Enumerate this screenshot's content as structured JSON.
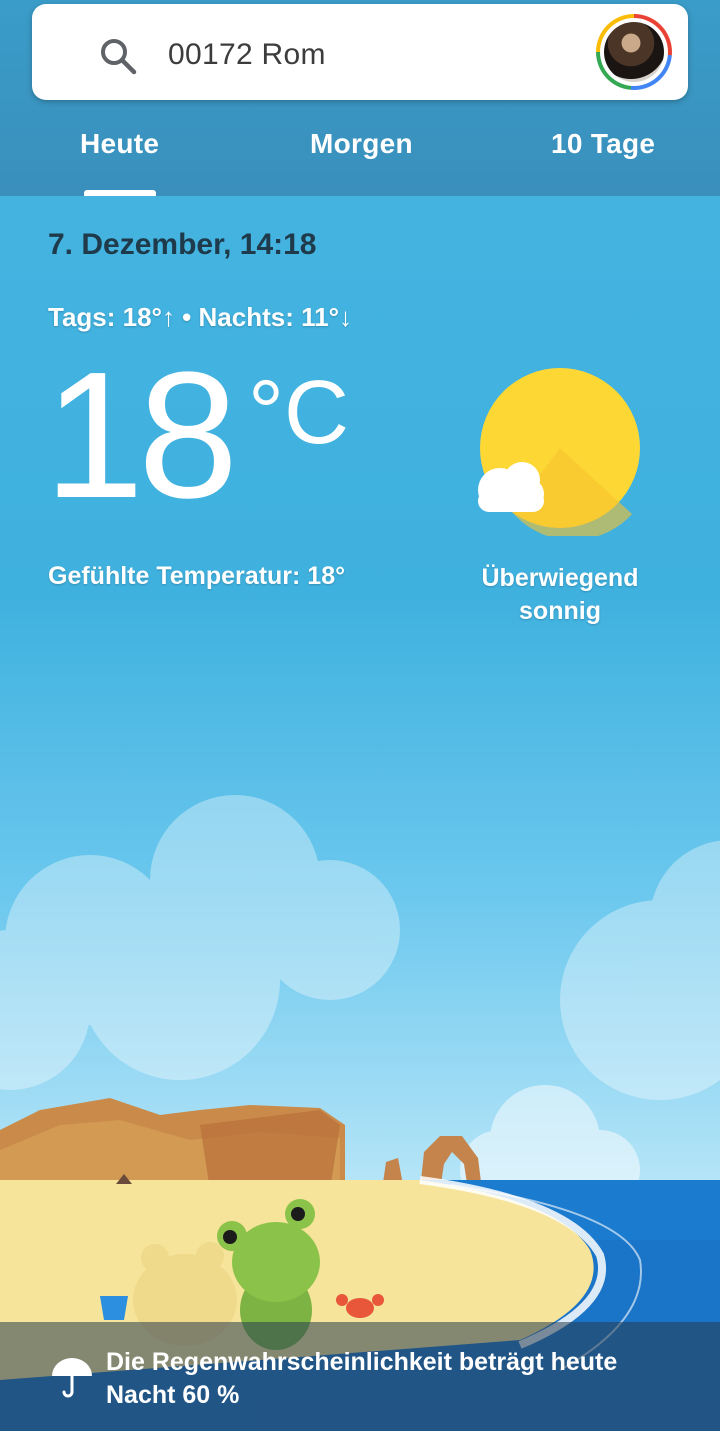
{
  "search": {
    "value": "00172 Rom",
    "icon": "search-icon"
  },
  "tabs": [
    {
      "label": "Heute",
      "selected": true
    },
    {
      "label": "Morgen",
      "selected": false
    },
    {
      "label": "10 Tage",
      "selected": false
    }
  ],
  "weather": {
    "date_time": "7. Dezember, 14:18",
    "day_night": "Tags: 18°↑ • Nachts: 11°↓",
    "temperature": "18",
    "unit": "°C",
    "feels_like": "Gefühlte Temperatur: 18°",
    "condition_line1": "Überwiegend",
    "condition_line2": "sonnig",
    "icon": "sun-cloud-icon"
  },
  "rain_notice": {
    "text": "Die Regenwahrscheinlichkeit beträgt heute Nacht 60 %",
    "icon": "umbrella-icon"
  },
  "colors": {
    "header": "#3a8fbb",
    "sky": "#3fb1df",
    "sun": "#fbc02d",
    "sea": "#1a74c8",
    "sand": "#f6e49a"
  }
}
